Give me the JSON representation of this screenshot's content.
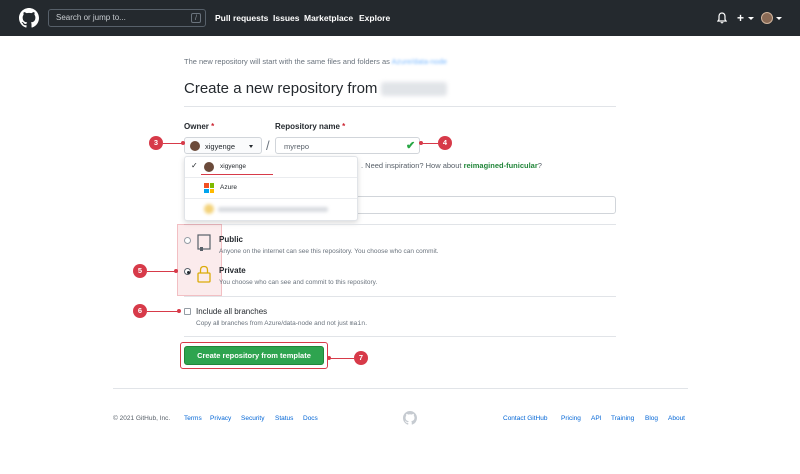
{
  "header": {
    "search_placeholder": "Search or jump to...",
    "search_key": "/",
    "nav": [
      "Pull requests",
      "Issues",
      "Marketplace",
      "Explore"
    ],
    "plus": "+"
  },
  "intro": {
    "text": "The new repository will start with the same files and folders as",
    "template_link": "Azure/data-node"
  },
  "page_title": "Create a new repository from",
  "owner": {
    "label": "Owner",
    "required_mark": "*",
    "selected": "xigyenge"
  },
  "repo_name": {
    "label": "Repository name",
    "required_mark": "*",
    "value": "myrepo",
    "valid_mark": "✔"
  },
  "separator": "/",
  "hint": {
    "text": ". Need inspiration? How about",
    "suggestion": "reimagined-funicular",
    "end": "?"
  },
  "owner_dropdown": {
    "check": "✓",
    "items": [
      "xigyenge",
      "Azure"
    ]
  },
  "visibility": {
    "options": [
      {
        "title": "Public",
        "desc": "Anyone on the internet can see this repository. You choose who can commit.",
        "selected": false
      },
      {
        "title": "Private",
        "desc": "You choose who can see and commit to this repository.",
        "selected": true
      }
    ]
  },
  "include_branches": {
    "label": "Include all branches",
    "desc_pre": "Copy all branches from Azure/data-node and not just",
    "desc_code": "main",
    "desc_post": "."
  },
  "create_button": "Create repository from template",
  "badges": [
    "3",
    "4",
    "5",
    "6",
    "7"
  ],
  "footer": {
    "copyright": "© 2021 GitHub, Inc.",
    "left_links": [
      "Terms",
      "Privacy",
      "Security",
      "Status",
      "Docs"
    ],
    "right_links": [
      "Contact GitHub",
      "Pricing",
      "API",
      "Training",
      "Blog",
      "About"
    ]
  },
  "colors": {
    "header_bg": "#24292e",
    "primary_button": "#2ea44f",
    "annotation": "#d73a49",
    "link": "#0366d6"
  }
}
